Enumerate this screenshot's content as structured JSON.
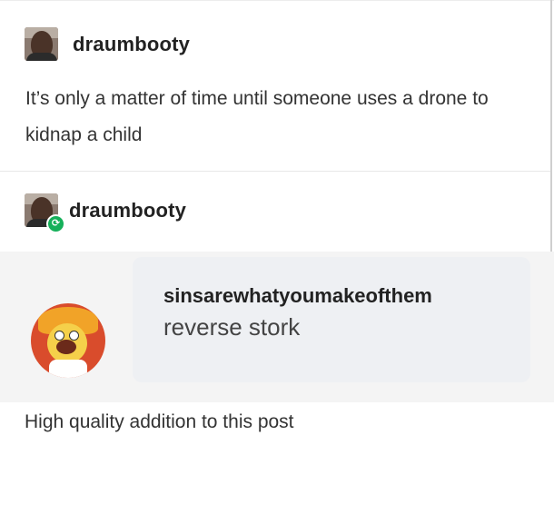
{
  "original_post": {
    "username": "draumbooty",
    "text": "It’s only a matter of time until someone uses a drone to kidnap a child"
  },
  "reblog": {
    "username": "draumbooty",
    "badge_icon": "reblog-icon"
  },
  "reply": {
    "username": "sinsarewhatyoumakeofthem",
    "text": "reverse stork"
  },
  "footer": {
    "text": "High quality addition to this post"
  },
  "colors": {
    "reblog_badge": "#16b05a",
    "reply_background": "#f4f4f4"
  }
}
